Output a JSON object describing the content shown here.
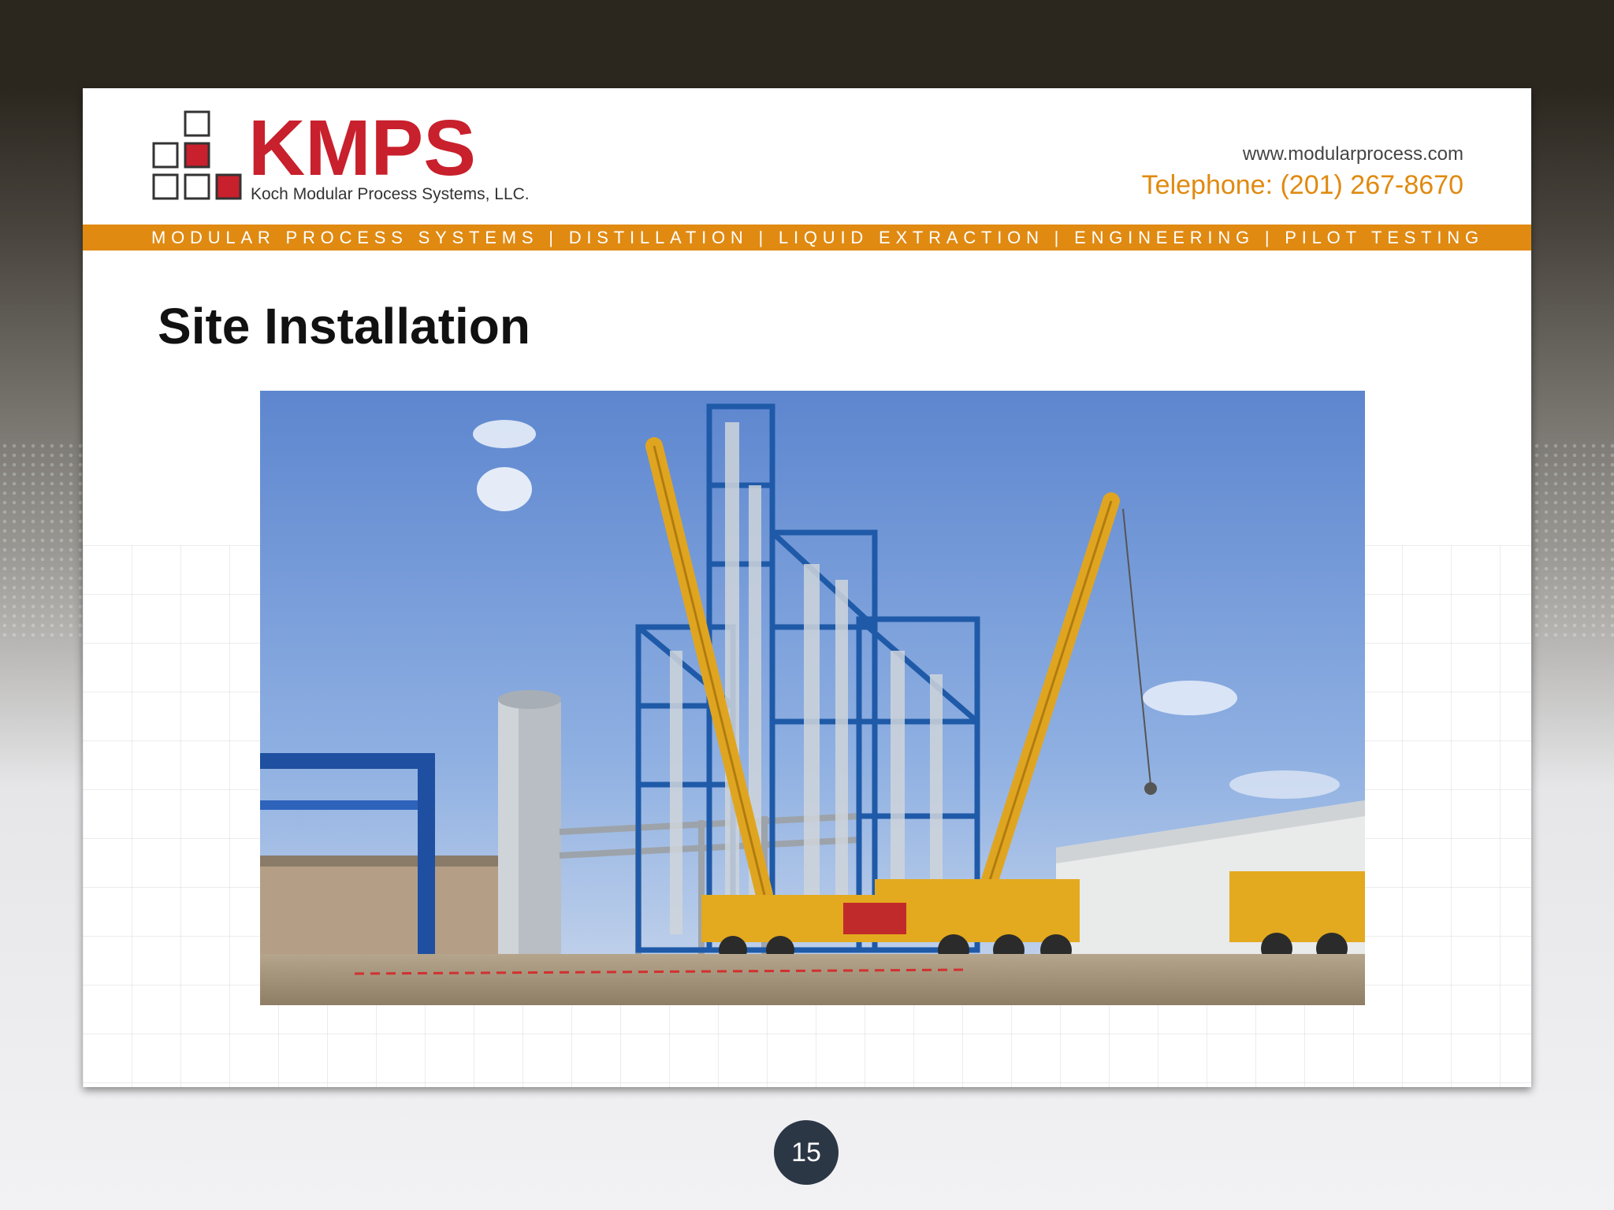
{
  "slide": {
    "logo": {
      "name": "KMPS",
      "subtitle": "Koch Modular Process Systems, LLC.",
      "brand_red": "#c8202c"
    },
    "contact": {
      "url": "www.modularprocess.com",
      "phone": "Telephone: (201) 267-8670"
    },
    "banner": "MODULAR PROCESS SYSTEMS | DISTILLATION | LIQUID EXTRACTION | ENGINEERING | PILOT TESTING",
    "title": "Site Installation",
    "photo_label": "crane-site-photo",
    "page_number": "15"
  },
  "colors": {
    "accent_orange": "#e08a12",
    "page_badge": "#2c3746"
  }
}
